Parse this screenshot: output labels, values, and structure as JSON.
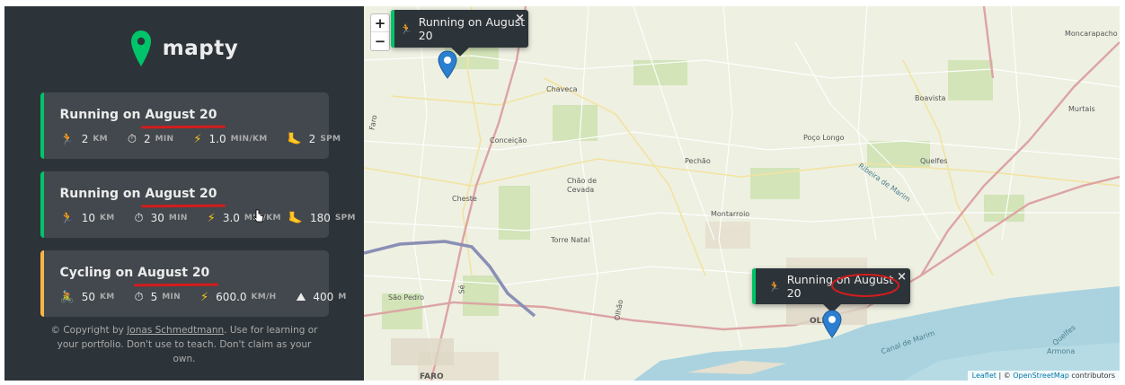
{
  "colors": {
    "sidebar_bg": "#2d3439",
    "card_bg": "#42484d",
    "running": "#00c46a",
    "cycling": "#ffb545",
    "annotation_red": "#d41c1c"
  },
  "sidebar": {
    "logo": {
      "icon": "map-pin-icon",
      "text": "mapty"
    },
    "workouts": [
      {
        "type": "running",
        "title_prefix": "Running on ",
        "title_date": "August 20",
        "details": [
          {
            "icon": "runner-icon",
            "value": "2",
            "unit": "KM"
          },
          {
            "icon": "stopwatch-icon",
            "value": "2",
            "unit": "MIN"
          },
          {
            "icon": "lightning-icon",
            "value": "1.0",
            "unit": "MIN/KM"
          },
          {
            "icon": "footprint-icon",
            "value": "2",
            "unit": "SPM"
          }
        ]
      },
      {
        "type": "running",
        "title_prefix": "Running on ",
        "title_date": "August 20",
        "details": [
          {
            "icon": "runner-icon",
            "value": "10",
            "unit": "KM"
          },
          {
            "icon": "stopwatch-icon",
            "value": "30",
            "unit": "MIN"
          },
          {
            "icon": "lightning-icon",
            "value": "3.0",
            "unit": "MIN/KM"
          },
          {
            "icon": "footprint-icon",
            "value": "180",
            "unit": "SPM"
          }
        ]
      },
      {
        "type": "cycling",
        "title_prefix": "Cycling on ",
        "title_date": "August 20",
        "details": [
          {
            "icon": "cyclist-icon",
            "value": "50",
            "unit": "KM"
          },
          {
            "icon": "stopwatch-icon",
            "value": "5",
            "unit": "MIN"
          },
          {
            "icon": "lightning-icon",
            "value": "600.0",
            "unit": "KM/H"
          },
          {
            "icon": "mountain-icon",
            "value": "400",
            "unit": "M"
          }
        ]
      }
    ],
    "copyright": {
      "prefix": "© Copyright by ",
      "link": "Jonas Schmedtmann",
      "suffix": ". Use for learning or your portfolio. Don't use to teach. Don't claim as your own."
    }
  },
  "map": {
    "zoom_in": "+",
    "zoom_out": "−",
    "popups": [
      {
        "icon": "runner-icon",
        "text": "Running on August 20",
        "close": "×"
      },
      {
        "icon": "runner-icon",
        "text_prefix": "Running on ",
        "text_date": "August 20",
        "close": "×"
      }
    ],
    "places": [
      "Chaveca",
      "Conceição",
      "Faro",
      "Chão de",
      "Cevada",
      "Pechão",
      "Poço Longo",
      "Boavista",
      "Murtais",
      "Quelfes",
      "Moncarapacho",
      "Montarroio",
      "Torre Natal",
      "São Pedro",
      "Sé",
      "FARO",
      "OLHÃO",
      "Armona",
      "Ribeira de Marim",
      "Canal de Marim",
      "Olhão",
      "Cheste",
      "Quelfes"
    ],
    "attribution": {
      "leaflet": "Leaflet",
      "sep": " | © ",
      "osm": "OpenStreetMap",
      "suffix": " contributors"
    }
  }
}
